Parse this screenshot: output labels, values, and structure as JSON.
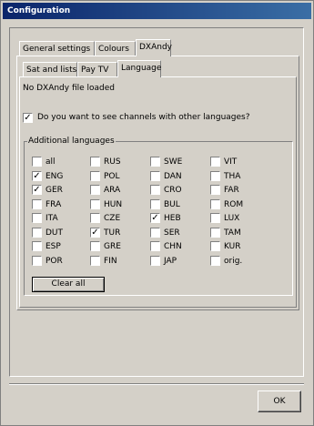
{
  "window": {
    "title": "Configuration"
  },
  "tabs_top": [
    {
      "label": "General settings",
      "active": false
    },
    {
      "label": "Colours",
      "active": false
    },
    {
      "label": "DXAndy",
      "active": true
    }
  ],
  "tabs_sub": [
    {
      "label": "Sat and lists",
      "active": false
    },
    {
      "label": "Pay TV",
      "active": false
    },
    {
      "label": "Language",
      "active": true
    }
  ],
  "status_text": "No DXAndy file loaded",
  "question": {
    "label": "Do you want to see channels with other languages?",
    "checked": true
  },
  "group_title": "Additional languages",
  "languages": [
    [
      "all",
      false
    ],
    [
      "RUS",
      false
    ],
    [
      "SWE",
      false
    ],
    [
      "VIT",
      false
    ],
    [
      "ENG",
      true
    ],
    [
      "POL",
      false
    ],
    [
      "DAN",
      false
    ],
    [
      "THA",
      false
    ],
    [
      "GER",
      true
    ],
    [
      "ARA",
      false
    ],
    [
      "CRO",
      false
    ],
    [
      "FAR",
      false
    ],
    [
      "FRA",
      false
    ],
    [
      "HUN",
      false
    ],
    [
      "BUL",
      false
    ],
    [
      "ROM",
      false
    ],
    [
      "ITA",
      false
    ],
    [
      "CZE",
      false
    ],
    [
      "HEB",
      true
    ],
    [
      "LUX",
      false
    ],
    [
      "DUT",
      false
    ],
    [
      "TUR",
      true
    ],
    [
      "SER",
      false
    ],
    [
      "TAM",
      false
    ],
    [
      "ESP",
      false
    ],
    [
      "GRE",
      false
    ],
    [
      "CHN",
      false
    ],
    [
      "KUR",
      false
    ],
    [
      "POR",
      false
    ],
    [
      "FIN",
      false
    ],
    [
      "JAP",
      false
    ],
    [
      "orig.",
      false
    ]
  ],
  "clear_button": "Clear all",
  "ok_button": "OK"
}
